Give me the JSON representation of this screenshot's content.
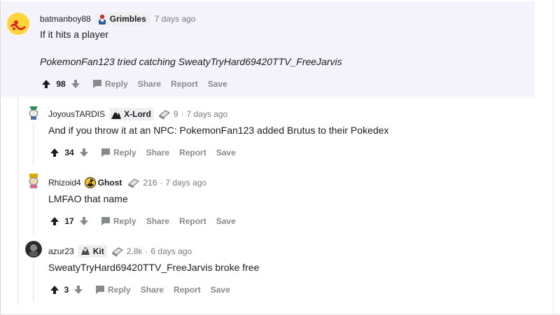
{
  "comments": [
    {
      "username": "batmanboy88",
      "flair": "Grimbles",
      "time": "7 days ago",
      "body_line1": "If it hits a player",
      "body_line2": "PokemonFan123 tried catching SweatyTryHard69420TTV_FreeJarvis",
      "score": "98",
      "avatar_icon": "snoo-avatar-icon",
      "flair_icon": "person-icon"
    },
    {
      "username": "JoyousTARDIS",
      "flair": "X-Lord",
      "karma": "9",
      "time": "7 days ago",
      "body": "And if you throw it at an NPC: PokemonFan123 added Brutus to their Pokedex",
      "score": "34",
      "avatar_icon": "snoo-avatar-icon",
      "flair_icon": "mountain-icon"
    },
    {
      "username": "Rhizoid4",
      "flair": "Ghost",
      "karma": "216",
      "time": "7 days ago",
      "body": "LMFAO that name",
      "score": "17",
      "avatar_icon": "snoo-avatar-icon",
      "flair_icon": "radiation-icon"
    },
    {
      "username": "azur23",
      "flair": "Kit",
      "karma": "2.8k",
      "time": "6 days ago",
      "body": "SweatyTryHard69420TTV_FreeJarvis broke free",
      "score": "3",
      "avatar_icon": "snoo-avatar-icon",
      "flair_icon": "kit-icon"
    }
  ],
  "actions": {
    "reply": "Reply",
    "share": "Share",
    "report": "Report",
    "save": "Save"
  },
  "separator": "·",
  "colors": {
    "highlight_bg": "#f4f2fb",
    "meta_gray": "#787c7e",
    "action_gray": "#878a8c",
    "flair_bg": "#edeff1"
  }
}
